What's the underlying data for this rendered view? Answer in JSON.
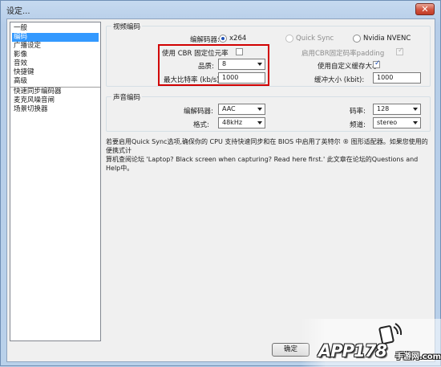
{
  "window": {
    "title": "设定...",
    "close_glyph": "✕"
  },
  "sidebar": {
    "items": [
      {
        "label": "一般",
        "selected": false
      },
      {
        "label": "编码",
        "selected": true
      },
      {
        "label": "广播设定",
        "selected": false
      },
      {
        "label": "影像",
        "selected": false
      },
      {
        "label": "音效",
        "selected": false
      },
      {
        "label": "快捷键",
        "selected": false
      },
      {
        "label": "高级",
        "selected": false
      },
      {
        "label": "快速同步编码器",
        "selected": false
      },
      {
        "label": "麦克风噪音闸",
        "selected": false
      },
      {
        "label": "场景切换器",
        "selected": false
      }
    ]
  },
  "video": {
    "group_title": "视频编码",
    "encoder_label": "编解码器:",
    "encoder_options": [
      {
        "label": "x264",
        "selected": true,
        "enabled": true
      },
      {
        "label": "Quick Sync",
        "selected": false,
        "enabled": false
      },
      {
        "label": "Nvidia NVENC",
        "selected": false,
        "enabled": true
      }
    ],
    "cbr_label": "使用 CBR 固定位元率",
    "cbr_checked": false,
    "cbr_padding_label": "启用CBR固定码率padding",
    "cbr_padding_checked": true,
    "quality_label": "品质:",
    "quality_value": "8",
    "custom_buffer_label": "使用自定义缓存大小",
    "custom_buffer_checked": true,
    "max_bitrate_label": "最大比特率 (kb/s):",
    "max_bitrate_value": "1000",
    "buffer_size_label": "缓冲大小 (kbit):",
    "buffer_size_value": "1000"
  },
  "audio": {
    "group_title": "声音编码",
    "codec_label": "编解码器:",
    "codec_value": "AAC",
    "bitrate_label": "码率:",
    "bitrate_value": "128",
    "format_label": "格式:",
    "format_value": "48kHz",
    "channel_label": "频道:",
    "channel_value": "stereo"
  },
  "note": {
    "line1": "若要启用Quick Sync选项,确保你的 CPU 支持快速同步和在 BIOS 中启用了英特尔 ® 图形适配器。如果您使用的便携式计",
    "line2": "算机查阅论坛 'Laptop? Black screen when capturing? Read here first.' 此文章在论坛的Questions and Help中。"
  },
  "buttons": {
    "ok_label": "确定"
  },
  "watermark": {
    "text": "APP178",
    "sub": "手游网",
    "domain": ".com"
  }
}
